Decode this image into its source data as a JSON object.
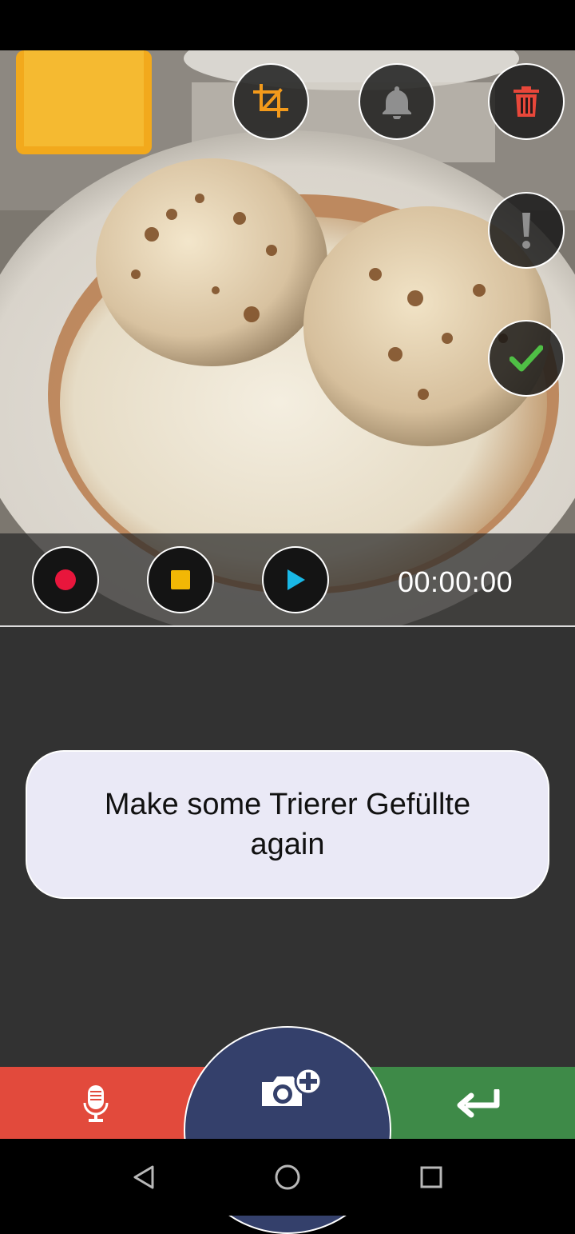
{
  "toolbar": {
    "crop_icon": "crop-icon",
    "alarm_icon": "bell-icon",
    "delete_icon": "trash-icon",
    "priority_icon": "exclamation-icon",
    "done_icon": "check-icon"
  },
  "player": {
    "record_icon": "record-icon",
    "stop_icon": "stop-icon",
    "play_icon": "play-icon",
    "timer": "00:00:00"
  },
  "note": {
    "text": "Make some Trierer Gefüllte again"
  },
  "bottom_bar": {
    "mic_icon": "microphone-icon",
    "camera_icon": "camera-add-icon",
    "enter_icon": "return-icon"
  },
  "nav": {
    "back_icon": "back-triangle-icon",
    "home_icon": "home-circle-icon",
    "recents_icon": "recents-square-icon"
  },
  "colors": {
    "record": "#e8163c",
    "stop": "#f2b705",
    "play": "#19b8e6",
    "crop": "#f39a1b",
    "delete": "#e8473a",
    "check": "#4fbf45",
    "mic_bar": "#e24a3c",
    "enter_bar": "#3e8a48",
    "camera_dome": "#34406b",
    "note_bubble": "#eae9f6",
    "content_bg": "#323232"
  }
}
